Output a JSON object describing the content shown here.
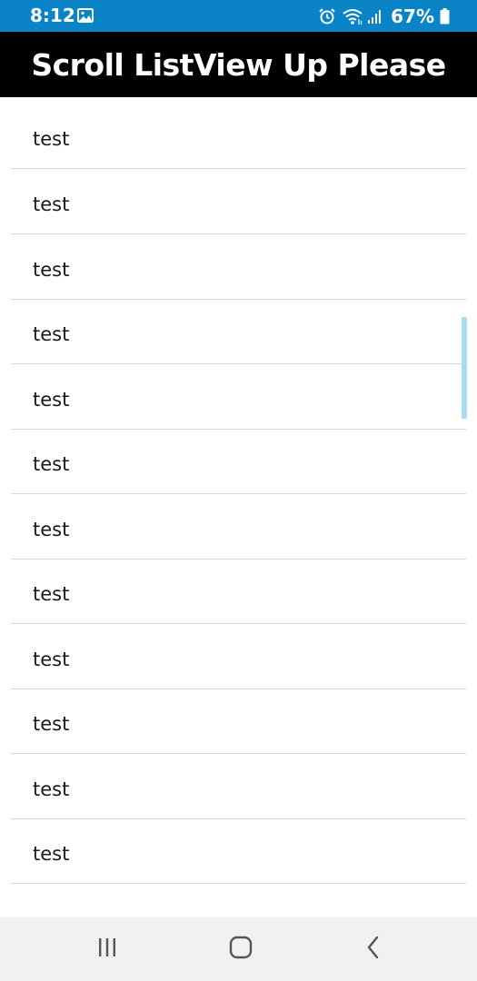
{
  "status_bar": {
    "time": "8:12",
    "battery_percent": "67%",
    "background_color": "#0a84c6",
    "icons": [
      "gallery-icon",
      "alarm-icon",
      "wifi-icon",
      "signal-icon",
      "battery-icon"
    ]
  },
  "app_bar": {
    "title": "Scroll ListView Up Please",
    "background_color": "#000000"
  },
  "list": {
    "items": [
      {
        "label": "test"
      },
      {
        "label": "test"
      },
      {
        "label": "test"
      },
      {
        "label": "test"
      },
      {
        "label": "test"
      },
      {
        "label": "test"
      },
      {
        "label": "test"
      },
      {
        "label": "test"
      },
      {
        "label": "test"
      },
      {
        "label": "test"
      },
      {
        "label": "test"
      },
      {
        "label": "test"
      }
    ]
  },
  "nav_bar": {
    "buttons": [
      "recent-apps-icon",
      "home-icon",
      "back-icon"
    ]
  }
}
